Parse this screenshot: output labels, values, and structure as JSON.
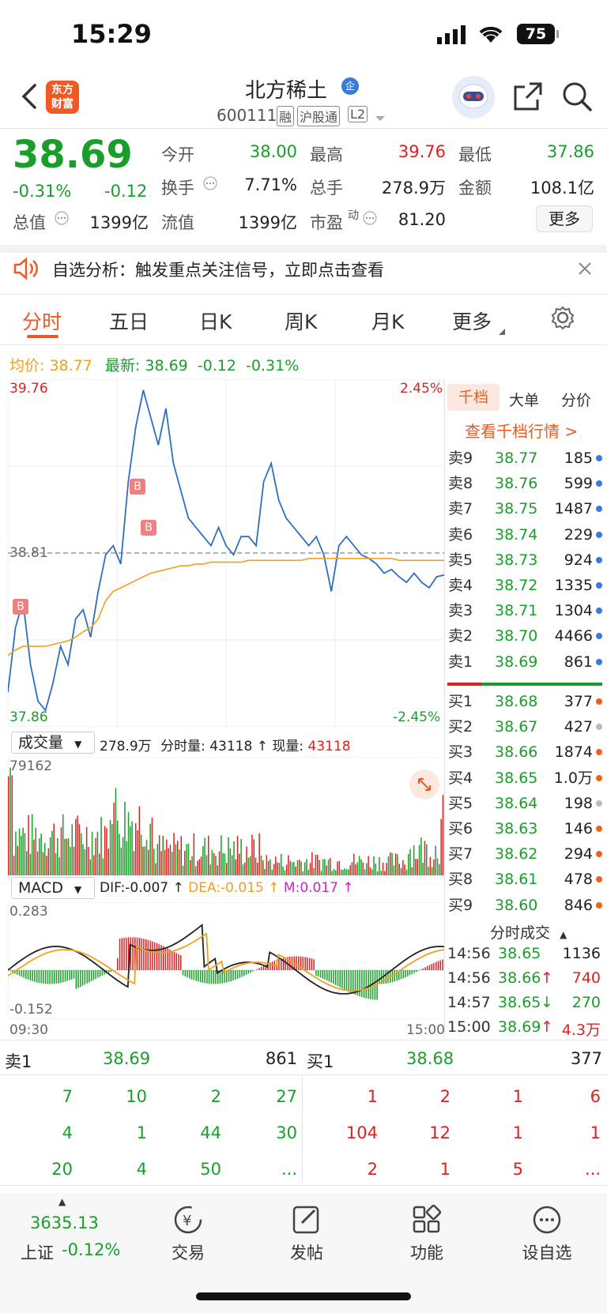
{
  "status": {
    "time": "15:29",
    "battery": "75"
  },
  "header": {
    "title": "北方稀土",
    "badge": "企",
    "code": "600111",
    "tags": [
      "融",
      "沪股通",
      "L2"
    ],
    "logo_line1": "东方",
    "logo_line2": "财富"
  },
  "quote": {
    "price": "38.69",
    "pct": "-0.31%",
    "chg": "-0.12",
    "open_label": "今开",
    "open": "38.00",
    "high_label": "最高",
    "high": "39.76",
    "low_label": "最低",
    "low": "37.86",
    "turnover_label": "换手",
    "turnover": "7.71%",
    "volume_label": "总手",
    "volume": "278.9万",
    "amount_label": "金额",
    "amount": "108.1亿",
    "mcap_label": "总值",
    "mcap": "1399亿",
    "float_label": "流值",
    "float": "1399亿",
    "pe_label": "市盈",
    "pe_sup": "动",
    "pe": "81.20",
    "more": "更多"
  },
  "notice": {
    "text": "自选分析：触发重点关注信号，立即点击查看"
  },
  "tabs": [
    "分时",
    "五日",
    "日K",
    "周K",
    "月K",
    "更多"
  ],
  "chart_info": {
    "avg_label": "均价:",
    "avg": "38.77",
    "latest_label": "最新:",
    "latest": "38.69",
    "chg": "-0.12",
    "pct": "-0.31%"
  },
  "chart_axis": {
    "top": "39.76",
    "mid": "38.81",
    "bottom": "37.86",
    "top_pct": "2.45%",
    "bottom_pct": "-2.45%",
    "buy_marker": "B"
  },
  "chart_data": {
    "type": "line",
    "series": [
      {
        "values": [
          38.05,
          38.4,
          38.55,
          38.2,
          38.0,
          37.95,
          38.1,
          38.3,
          38.2,
          38.45,
          38.5,
          38.35,
          38.6,
          38.8,
          38.85,
          38.75,
          39.2,
          39.5,
          39.7,
          39.55,
          39.4,
          39.6,
          39.3,
          39.15,
          39.0,
          38.95,
          38.9,
          38.85,
          38.95,
          38.85,
          38.8,
          38.9,
          38.9,
          38.85,
          39.2,
          39.3,
          39.1,
          39.0,
          38.95,
          38.9,
          38.85,
          38.9,
          38.8,
          38.6,
          38.85,
          38.9,
          38.85,
          38.8,
          38.78,
          38.75,
          38.7,
          38.72,
          38.68,
          38.65,
          38.7,
          38.65,
          38.62,
          38.68,
          38.69
        ]
      },
      {
        "values": [
          38.25,
          38.28,
          38.3,
          38.3,
          38.3,
          38.3,
          38.31,
          38.32,
          38.33,
          38.35,
          38.38,
          38.4,
          38.45,
          38.55,
          38.6,
          38.62,
          38.64,
          38.66,
          38.68,
          38.7,
          38.71,
          38.72,
          38.73,
          38.74,
          38.74,
          38.75,
          38.75,
          38.76,
          38.76,
          38.76,
          38.76,
          38.76,
          38.77,
          38.77,
          38.77,
          38.77,
          38.77,
          38.77,
          38.77,
          38.77,
          38.78,
          38.78,
          38.78,
          38.78,
          38.78,
          38.78,
          38.78,
          38.78,
          38.78,
          38.78,
          38.78,
          38.78,
          38.77,
          38.77,
          38.77,
          38.77,
          38.77,
          38.77,
          38.77
        ]
      }
    ],
    "ylim": [
      37.86,
      39.76
    ]
  },
  "volume": {
    "label": "成交量",
    "total": "278.9万",
    "minute_label": "分时量:",
    "minute": "43118",
    "now_label": "现量:",
    "now": "43118",
    "max": "79162"
  },
  "macd": {
    "label": "MACD",
    "dif": "DIF:-0.007",
    "dea": "DEA:-0.015",
    "m": "M:0.017",
    "top": "0.283",
    "bottom": "-0.152",
    "start": "09:30",
    "end": "15:00"
  },
  "depth_tabs": [
    "千档",
    "大单",
    "分价"
  ],
  "depth_link": "查看千档行情 >",
  "asks": [
    {
      "l": "卖9",
      "p": "38.77",
      "v": "185",
      "c": "#3a7bd5"
    },
    {
      "l": "卖8",
      "p": "38.76",
      "v": "599",
      "c": "#3a7bd5"
    },
    {
      "l": "卖7",
      "p": "38.75",
      "v": "1487",
      "c": "#3a7bd5"
    },
    {
      "l": "卖6",
      "p": "38.74",
      "v": "229",
      "c": "#3a7bd5"
    },
    {
      "l": "卖5",
      "p": "38.73",
      "v": "924",
      "c": "#3a7bd5"
    },
    {
      "l": "卖4",
      "p": "38.72",
      "v": "1335",
      "c": "#3a7bd5"
    },
    {
      "l": "卖3",
      "p": "38.71",
      "v": "1304",
      "c": "#3a7bd5"
    },
    {
      "l": "卖2",
      "p": "38.70",
      "v": "4466",
      "c": "#3a7bd5"
    },
    {
      "l": "卖1",
      "p": "38.69",
      "v": "861",
      "c": "#3a7bd5"
    }
  ],
  "bids": [
    {
      "l": "买1",
      "p": "38.68",
      "v": "377",
      "c": "#f06020"
    },
    {
      "l": "买2",
      "p": "38.67",
      "v": "427",
      "c": "#bbbbbb"
    },
    {
      "l": "买3",
      "p": "38.66",
      "v": "1874",
      "c": "#f06020"
    },
    {
      "l": "买4",
      "p": "38.65",
      "v": "1.0万",
      "c": "#f06020"
    },
    {
      "l": "买5",
      "p": "38.64",
      "v": "198",
      "c": "#bbbbbb"
    },
    {
      "l": "买6",
      "p": "38.63",
      "v": "146",
      "c": "#f06020"
    },
    {
      "l": "买7",
      "p": "38.62",
      "v": "294",
      "c": "#f06020"
    },
    {
      "l": "买8",
      "p": "38.61",
      "v": "478",
      "c": "#f06020"
    },
    {
      "l": "买9",
      "p": "38.60",
      "v": "846",
      "c": "#f06020"
    }
  ],
  "ticks_title": "分时成交",
  "ticks": [
    {
      "t": "14:56",
      "p": "38.65",
      "v": "1136",
      "arrow": ""
    },
    {
      "t": "14:56",
      "p": "38.66",
      "v": "740",
      "arrow": "↑"
    },
    {
      "t": "14:57",
      "p": "38.65",
      "v": "270",
      "arrow": "↓"
    },
    {
      "t": "15:00",
      "p": "38.69",
      "v": "4.3万",
      "arrow": "↑"
    }
  ],
  "queue": {
    "sell_label": "卖1",
    "sell_price": "38.69",
    "sell_vol": "861",
    "buy_label": "买1",
    "buy_price": "38.68",
    "buy_vol": "377",
    "sell_rows": [
      [
        "7",
        "10",
        "2",
        "27"
      ],
      [
        "4",
        "1",
        "44",
        "30"
      ],
      [
        "20",
        "4",
        "50",
        "..."
      ]
    ],
    "buy_rows": [
      [
        "1",
        "2",
        "1",
        "6"
      ],
      [
        "104",
        "12",
        "1",
        "1"
      ],
      [
        "2",
        "1",
        "5",
        "..."
      ]
    ]
  },
  "nav": {
    "index_val": "3635.13",
    "index_name": "上证",
    "index_pct": "-0.12%",
    "items": [
      "交易",
      "发帖",
      "功能",
      "设自选"
    ]
  }
}
